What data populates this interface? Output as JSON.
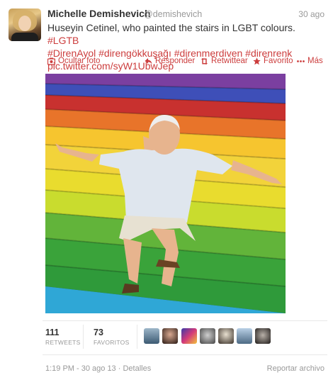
{
  "tweet": {
    "author_name": "Michelle Demishevich",
    "handle": "@demishevich",
    "date": "30 ago",
    "text_plain": "Huseyin Cetinel, who painted the stairs in LGBT colours. ",
    "hashtag_1": "#LGTB",
    "hashtag_2": "#DirenAyol",
    "hashtag_3": "#direngökkuşağı",
    "hashtag_4": "#direnmerdiven",
    "hashtag_5": "#direnrenk",
    "pic_link": "pic.twitter.com/syW1UbwJep"
  },
  "actions": {
    "hide_photo": "Ocultar foto",
    "reply": "Responder",
    "retweet": "Retwittear",
    "favorite": "Favorito",
    "more": "Más"
  },
  "stats": {
    "retweets_count": "111",
    "retweets_label": "RETWEETS",
    "favorites_count": "73",
    "favorites_label": "FAVORITOS"
  },
  "footer": {
    "timestamp": "1:19 PM - 30 ago 13",
    "separator": " · ",
    "details": "Detalles",
    "report": "Reportar archivo"
  },
  "colors": {
    "accent": "#cc3d3d",
    "stairs": [
      "#7b3fa0",
      "#3e4fb8",
      "#c8312f",
      "#e8742a",
      "#f2d33a",
      "#e9dc2e",
      "#62b43a",
      "#3aa33a",
      "#2fa7d6"
    ]
  }
}
